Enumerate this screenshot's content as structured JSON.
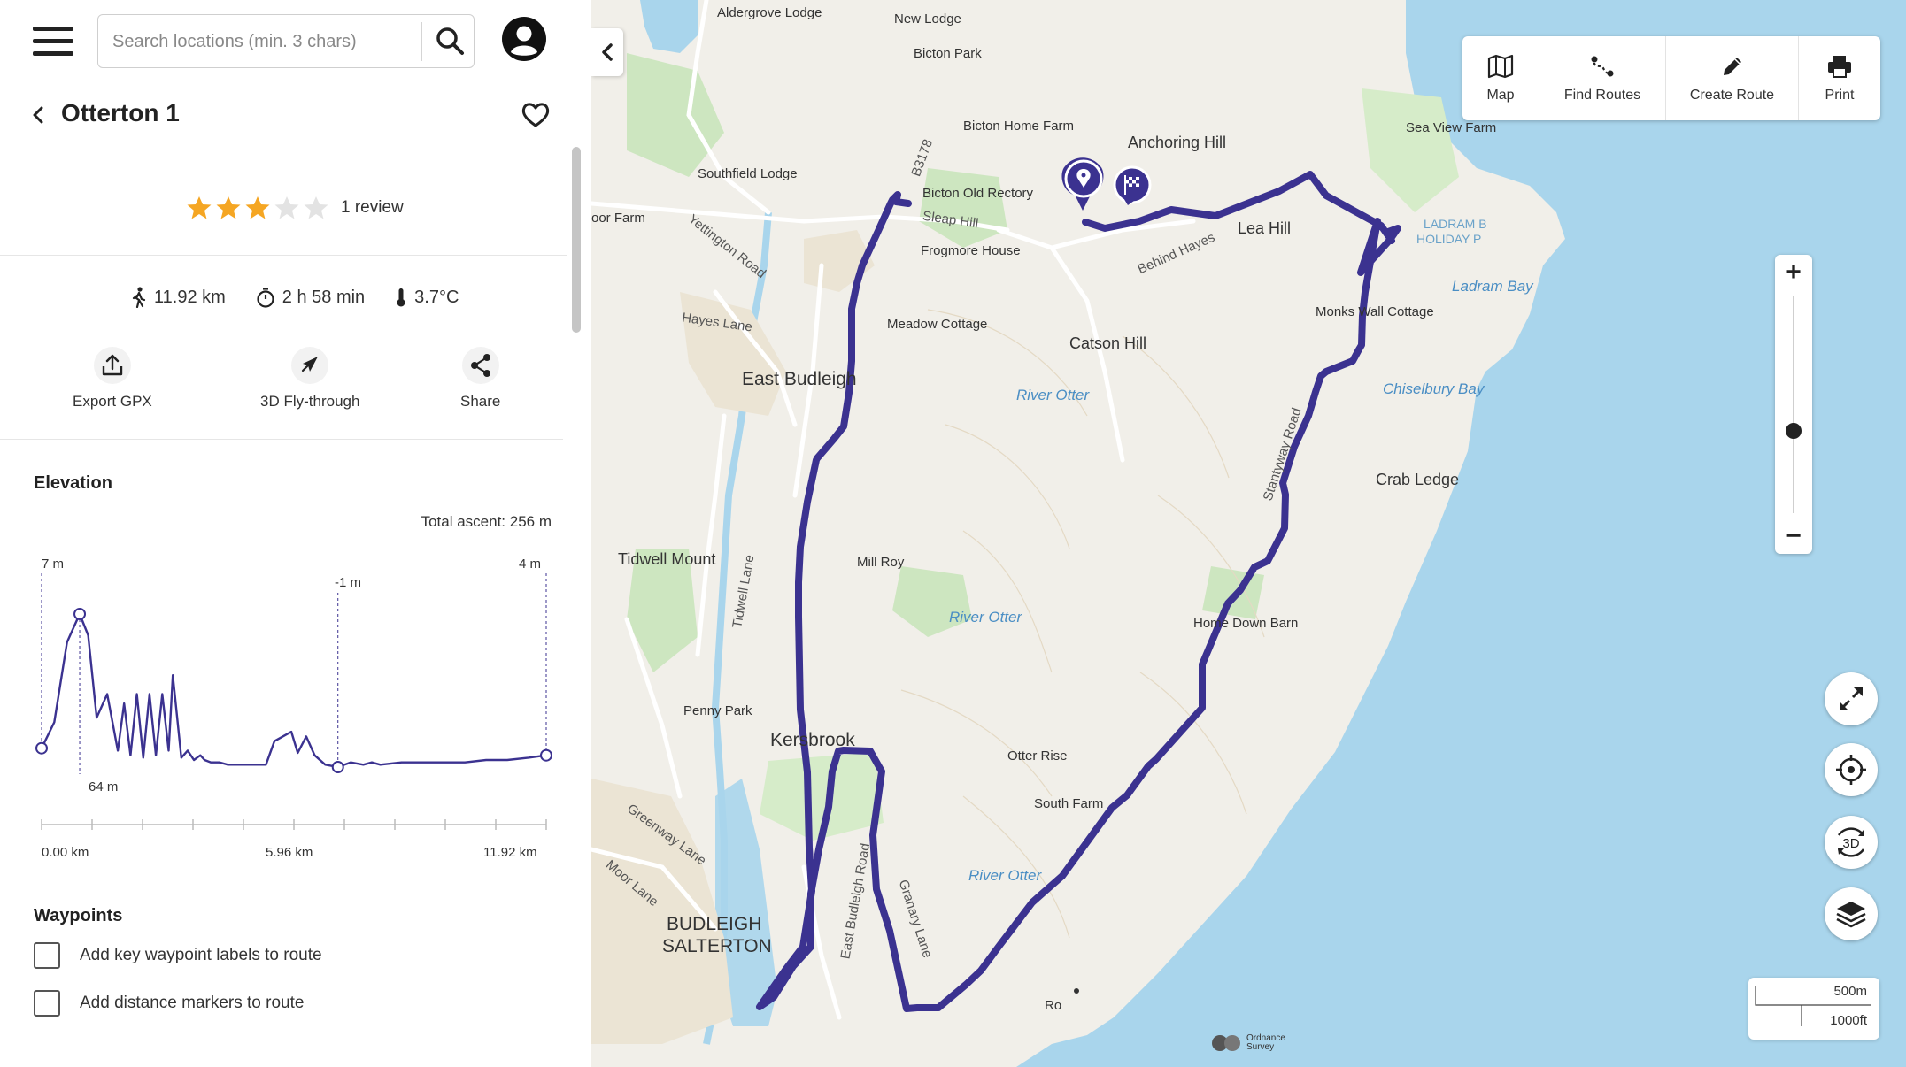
{
  "header": {
    "search_placeholder": "Search locations (min. 3 chars)"
  },
  "route": {
    "title": "Otterton 1",
    "rating": 3,
    "rating_max": 5,
    "review_count": "1 review",
    "distance": "11.92 km",
    "duration": "2 h 58 min",
    "temperature": "3.7°C"
  },
  "actions": [
    {
      "label": "Export GPX",
      "icon": "export-icon"
    },
    {
      "label": "3D Fly-through",
      "icon": "plane-icon"
    },
    {
      "label": "Share",
      "icon": "share-icon"
    }
  ],
  "elevation": {
    "heading": "Elevation",
    "total_ascent": "Total ascent: 256 m",
    "labels": {
      "start": "7 m",
      "max": "64 m",
      "mid": "-1 m",
      "end": "4 m"
    },
    "x_ticks": [
      "0.00 km",
      "5.96 km",
      "11.92 km"
    ]
  },
  "chart_data": {
    "type": "line",
    "title": "Elevation",
    "xlabel": "",
    "ylabel": "",
    "x_ticks": [
      "0.00 km",
      "5.96 km",
      "11.92 km"
    ],
    "xlim": [
      0,
      11.92
    ],
    "series": [
      {
        "x": [
          0,
          0.3,
          0.6,
          0.9,
          1.1,
          1.3,
          1.55,
          1.8,
          1.95,
          2.1,
          2.25,
          2.4,
          2.55,
          2.7,
          2.85,
          3.0,
          3.1,
          3.3,
          3.45,
          3.6,
          3.75,
          3.85,
          4.0,
          4.2,
          4.4,
          4.7,
          5.0,
          5.3,
          5.5,
          5.9,
          6.05,
          6.25,
          6.45,
          6.7,
          7.0,
          7.3,
          7.6,
          7.8,
          8.0,
          8.5,
          9.0,
          9.5,
          10.0,
          10.5,
          11.0,
          11.5,
          11.92
        ],
        "y": [
          7,
          18,
          52,
          64,
          55,
          20,
          30,
          6,
          26,
          4,
          30,
          3,
          30,
          4,
          30,
          6,
          38,
          3,
          6,
          2,
          4,
          2,
          1,
          1,
          0,
          0,
          0,
          0,
          10,
          14,
          5,
          12,
          4,
          0,
          -1,
          1,
          0,
          1,
          0,
          1,
          1,
          1,
          1,
          2,
          2,
          3,
          4
        ]
      }
    ]
  },
  "waypoints": {
    "heading": "Waypoints",
    "options": [
      {
        "label": "Add key waypoint labels to route",
        "checked": false
      },
      {
        "label": "Add distance markers to route",
        "checked": false
      }
    ]
  },
  "toolbar": [
    {
      "label": "Map",
      "icon": "map-icon"
    },
    {
      "label": "Find Routes",
      "icon": "find-routes-icon"
    },
    {
      "label": "Create Route",
      "icon": "pencil-icon"
    },
    {
      "label": "Print",
      "icon": "print-icon"
    }
  ],
  "zoom": {
    "plus": "+",
    "minus": "−",
    "level_fraction": 0.62
  },
  "scale": {
    "metric": "500m",
    "imperial": "1000ft"
  },
  "map_labels": {
    "aldergrove": "Aldergrove Lodge",
    "new_lodge": "New Lodge",
    "bicton_park": "Bicton Park",
    "bicton_home_farm": "Bicton Home Farm",
    "anchoring_hill": "Anchoring Hill",
    "sea_view_farm": "Sea View Farm",
    "southfield": "Southfield Lodge",
    "b3178": "B3178",
    "bicton_rectory": "Bicton Old Rectory",
    "sleap_hill": "Sleap Hill",
    "lea_hill": "Lea Hill",
    "moor_farm": "oor Farm",
    "yettington": "Yettington Road",
    "frogmore": "Frogmore House",
    "behind_hayes": "Behind Hayes",
    "ladram": "LADRAM B",
    "holiday": "HOLIDAY P",
    "ladram_bay": "Ladram Bay",
    "hayes_lane": "Hayes Lane",
    "meadow": "Meadow Cottage",
    "monks_wall": "Monks Wall Cottage",
    "catson_hill": "Catson Hill",
    "east_budleigh": "East Budleigh",
    "river_otter_1": "River Otter",
    "chiselbury": "Chiselbury Bay",
    "stantyway": "Stantyway Road",
    "crab_ledge": "Crab Ledge",
    "tidwell_mount": "Tidwell Mount",
    "mill_roy": "Mill Roy",
    "tidwell_lane": "Tidwell Lane",
    "river_otter_2": "River Otter",
    "home_down_barn": "Home Down Barn",
    "penny_park": "Penny Park",
    "kersbrook": "Kersbrook",
    "otter_rise": "Otter Rise",
    "south_farm": "South Farm",
    "greenway": "Greenway Lane",
    "moor_lane": "Moor Lane",
    "east_budleigh_road": "East Budleigh Road",
    "granary": "Granary Lane",
    "river_otter_3": "River Otter",
    "budleigh": "BUDLEIGH",
    "salterton": "SALTERTON",
    "rock": "Ro",
    "os": "Ordnance Survey"
  }
}
